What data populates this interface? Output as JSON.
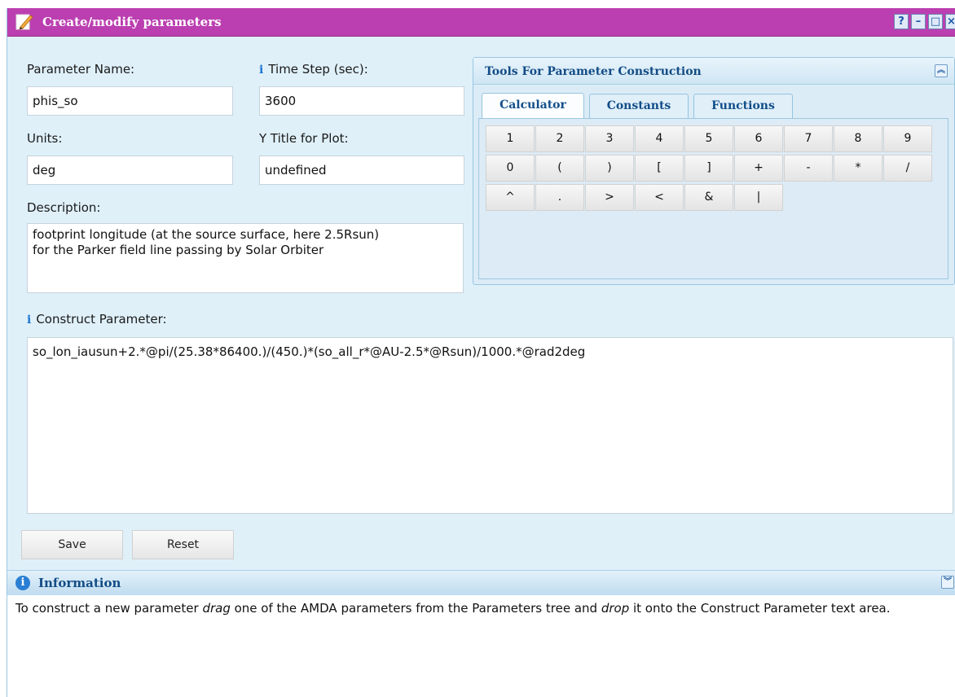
{
  "window": {
    "title": "Create/modify parameters",
    "controls": {
      "help": "?",
      "minimize": "–",
      "maximize": "□",
      "close": "×"
    }
  },
  "form": {
    "name_label": "Parameter Name:",
    "name_value": "phis_so",
    "timestep_label": "Time Step (sec):",
    "timestep_value": "3600",
    "units_label": "Units:",
    "units_value": "deg",
    "ytitle_label": "Y Title for Plot:",
    "ytitle_value": "undefined",
    "description_label": "Description:",
    "description_value": "footprint longitude (at the source surface, here 2.5Rsun)\nfor the Parker field line passing by Solar Orbiter",
    "construct_label": "Construct Parameter:",
    "construct_value": "so_lon_iausun+2.*@pi/(25.38*86400.)/(450.)*(so_all_r*@AU-2.5*@Rsun)/1000.*@rad2deg"
  },
  "info_marker": "i",
  "tools": {
    "title": "Tools For Parameter Construction",
    "collapse_icon": "chevron-double-up-icon",
    "tabs": [
      {
        "label": "Calculator",
        "active": true
      },
      {
        "label": "Constants",
        "active": false
      },
      {
        "label": "Functions",
        "active": false
      }
    ],
    "calculator_rows": [
      [
        "1",
        "2",
        "3",
        "4",
        "5",
        "6",
        "7",
        "8",
        "9"
      ],
      [
        "0",
        "(",
        ")",
        "[",
        "]",
        "+",
        "-",
        "*",
        "/"
      ],
      [
        "^",
        ".",
        ">",
        "<",
        "&",
        "|"
      ]
    ]
  },
  "buttons": {
    "save": "Save",
    "reset": "Reset"
  },
  "information": {
    "title": "Information",
    "icon_letter": "i",
    "expand_icon": "chevron-double-down-icon",
    "text_1": "To construct a new parameter ",
    "text_em1": "drag",
    "text_2": " one of the AMDA parameters from the Parameters tree and ",
    "text_em2": "drop",
    "text_3": " it onto the Construct Parameter text area."
  },
  "colors": {
    "titlebar": "#bb3fb1",
    "panel_bg": "#dff0f9",
    "tab_text": "#124e8a",
    "info_icon": "#1d76d2"
  }
}
